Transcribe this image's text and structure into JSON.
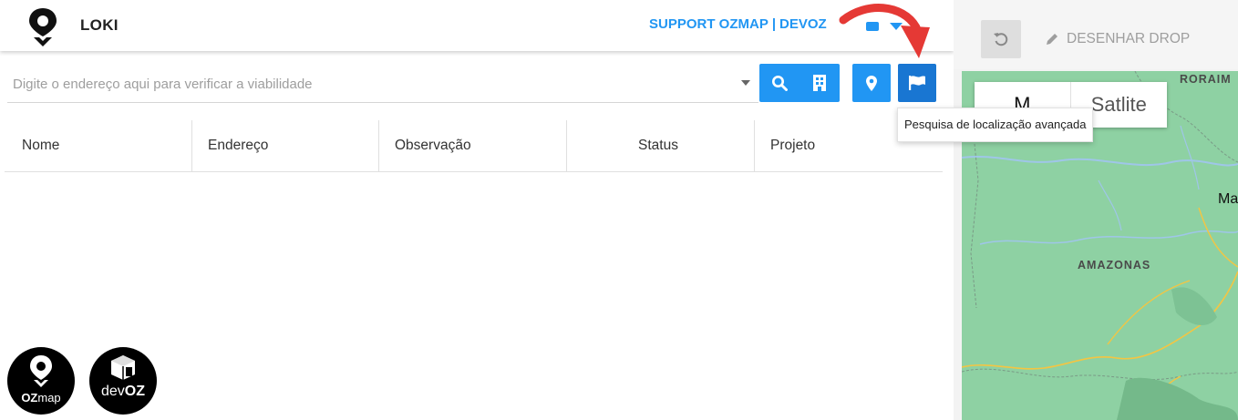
{
  "header": {
    "app_title": "LOKI",
    "support_label": "SUPPORT OZMAP",
    "separator": "|",
    "user_label": "DEVOZ",
    "logo_icon": "map-pin-logo-icon",
    "user_menu_icon": "chevron-down-icon"
  },
  "search": {
    "placeholder": "Digite o endereço aqui para verificar a viabilidade",
    "value": "",
    "dropdown_icon": "caret-down-icon"
  },
  "toolbar": {
    "buttons": [
      {
        "name": "search-button",
        "icon": "search-icon"
      },
      {
        "name": "building-button",
        "icon": "building-icon"
      },
      {
        "name": "location-button",
        "icon": "map-marker-icon"
      },
      {
        "name": "advanced-location-button",
        "icon": "flag-icon"
      }
    ],
    "accent": "#2196f3",
    "accent_active": "#1976d2"
  },
  "tooltip": {
    "text": "Pesquisa de localização avançada"
  },
  "table": {
    "columns": [
      "Nome",
      "Endereço",
      "Observação",
      "Status",
      "Projeto"
    ],
    "rows": []
  },
  "bottom_logos": [
    {
      "name": "ozmap-logo",
      "text_a": "OZ",
      "text_b": "map"
    },
    {
      "name": "devoz-logo",
      "text_a": "dev",
      "text_b": "OZ"
    }
  ],
  "map": {
    "undo_icon": "undo-icon",
    "draw_drop_label": "DESENHAR DROP",
    "draw_icon": "pencil-icon",
    "map_type_options": [
      "Map",
      "Satélite"
    ],
    "map_type_visible": [
      "M",
      "Sat",
      "lite"
    ],
    "labels": {
      "state": "AMAZONAS",
      "top_right": "RORAIM",
      "city": "Ma"
    },
    "land_color": "#8ed1a3"
  },
  "annotation": {
    "arrow_color": "#e53935"
  }
}
